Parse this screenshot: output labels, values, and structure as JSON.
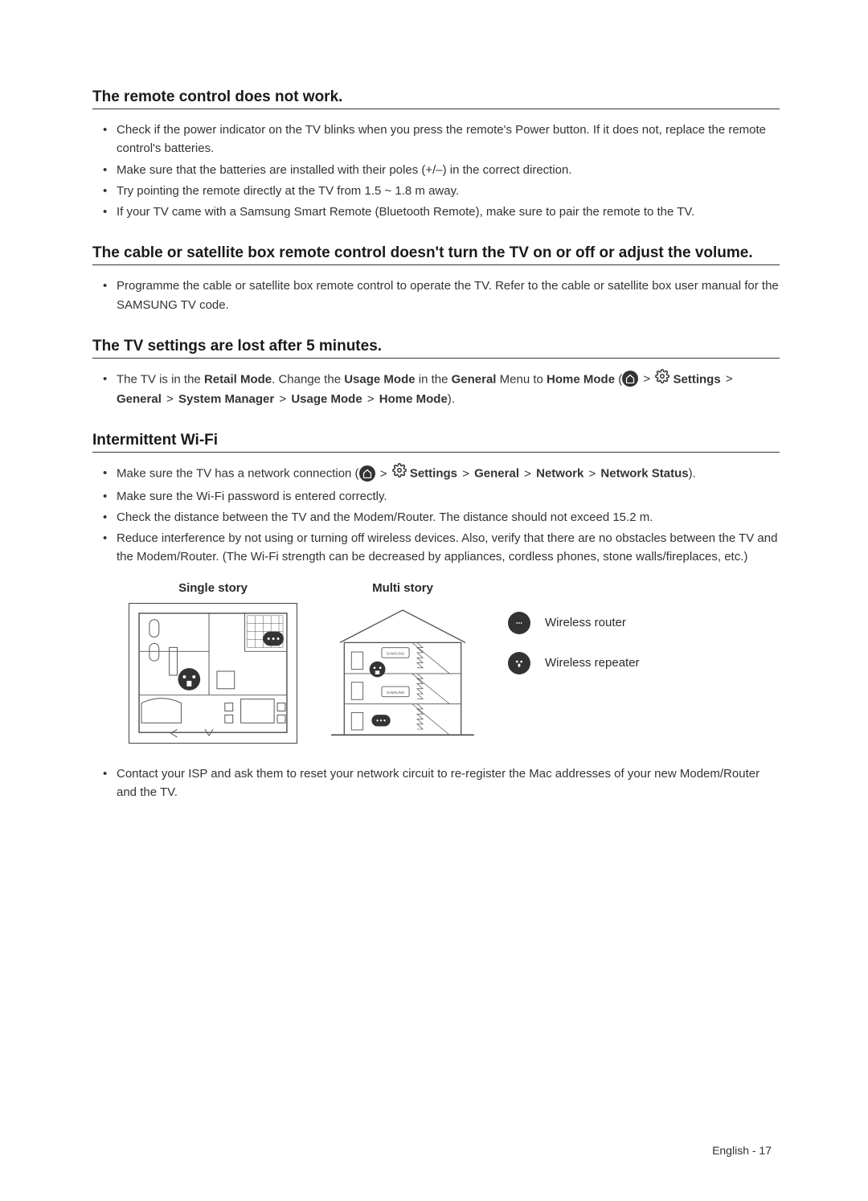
{
  "sections": {
    "remote": {
      "heading": "The remote control does not work.",
      "items": [
        "Check if the power indicator on the TV blinks when you press the remote's Power button. If it does not, replace the remote control's batteries.",
        "Make sure that the batteries are installed with their poles (+/–) in the correct direction.",
        "Try pointing the remote directly at the TV from 1.5 ~ 1.8 m away.",
        "If your TV came with a Samsung Smart Remote (Bluetooth Remote), make sure to pair the remote to the TV."
      ]
    },
    "cable": {
      "heading": "The cable or satellite box remote control doesn't turn the TV on or off or adjust the volume.",
      "items": [
        "Programme the cable or satellite box remote control to operate the TV. Refer to the cable or satellite box user manual for the SAMSUNG TV code."
      ]
    },
    "settings_lost": {
      "heading": "The TV settings are lost after 5 minutes.",
      "item_pre": "The TV is in the ",
      "retail_mode": "Retail Mode",
      "change_the": ". Change the ",
      "usage_mode": "Usage Mode",
      "in_the": " in the ",
      "general": "General",
      "menu_to": " Menu to ",
      "home_mode": "Home Mode",
      "path_settings": "Settings",
      "path_general": "General",
      "path_system_manager": "System Manager",
      "path_usage_mode": "Usage Mode",
      "path_home_mode": "Home Mode"
    },
    "wifi": {
      "heading": "Intermittent Wi-Fi",
      "item1_pre": "Make sure the TV has a network connection (",
      "item1_settings": "Settings",
      "item1_general": "General",
      "item1_network": "Network",
      "item1_network_status": "Network Status",
      "item1_post": ").",
      "items_rest": [
        "Make sure the Wi-Fi password is entered correctly.",
        "Check the distance between the TV and the Modem/Router. The distance should not exceed 15.2 m.",
        "Reduce interference by not using or turning off wireless devices. Also, verify that there are no obstacles between the TV and the Modem/Router. (The Wi-Fi strength can be decreased by appliances, cordless phones, stone walls/fireplaces, etc.)"
      ],
      "diagram": {
        "single": "Single story",
        "multi": "Multi story",
        "router": "Wireless router",
        "repeater": "Wireless repeater"
      },
      "item_after": "Contact your ISP and ask them to reset your network circuit to re-register the Mac addresses of your new Modem/Router and the TV."
    }
  },
  "footer": "English - 17",
  "chev": ">"
}
